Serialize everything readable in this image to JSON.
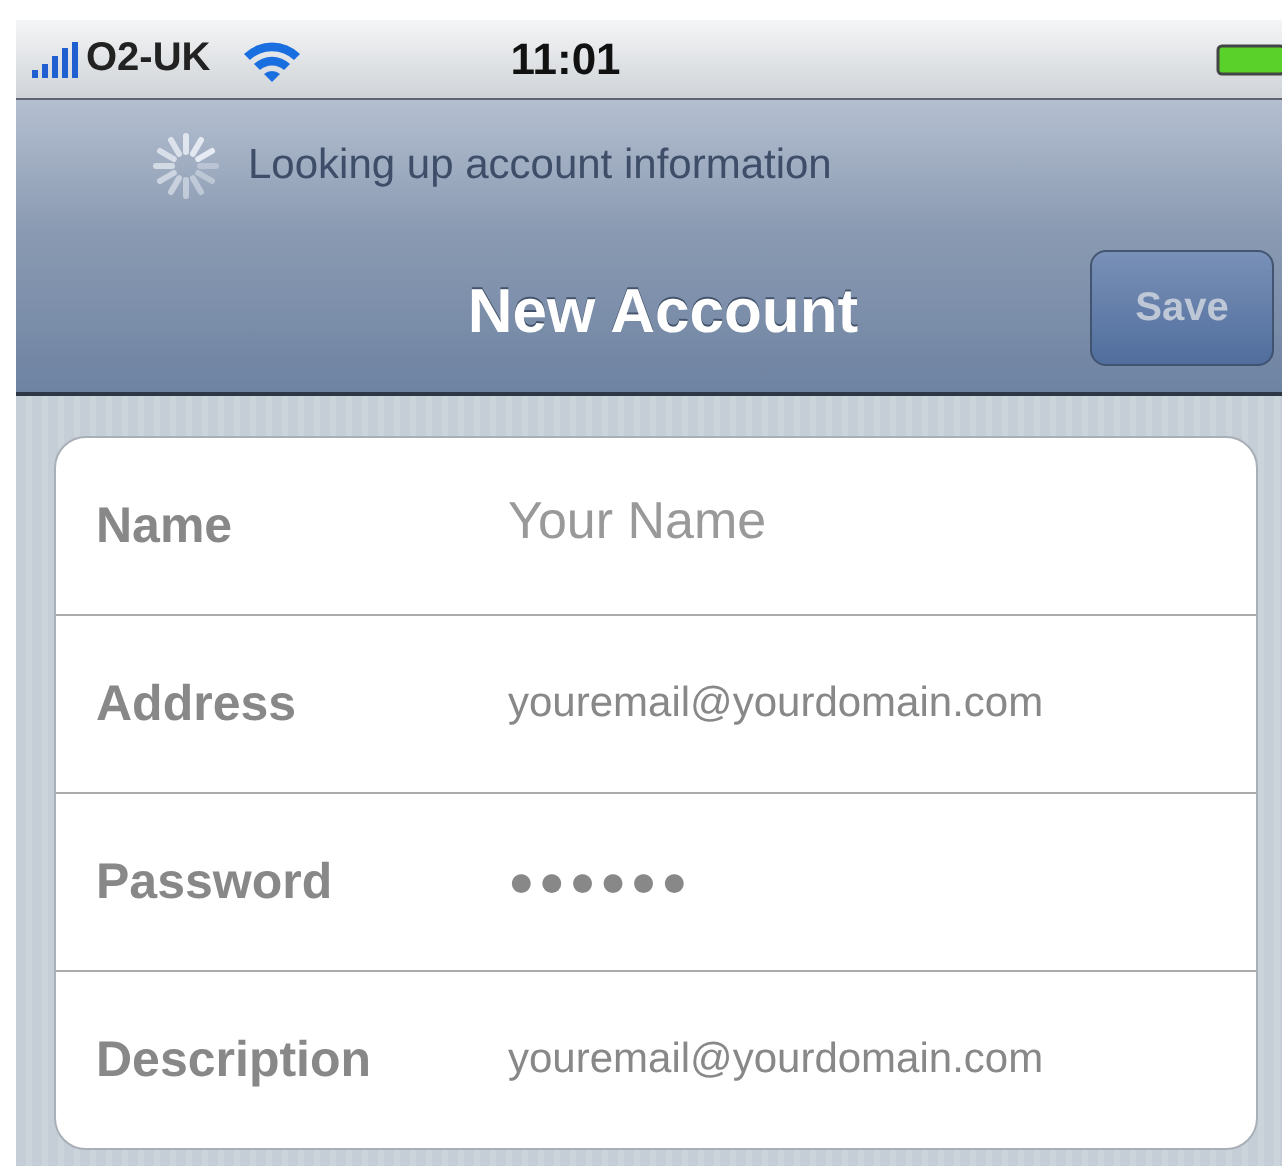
{
  "status_bar": {
    "carrier": "O2-UK",
    "time": "11:01"
  },
  "navigation_bar": {
    "activity": "Looking up account information",
    "title": "New Account",
    "save_button": {
      "label": "Save",
      "disabled": true
    }
  },
  "fields": [
    {
      "label": "Name",
      "placeholder": "Your Name"
    },
    {
      "label": "Address",
      "value": "youremail@yourdomain.com"
    },
    {
      "label": "Password",
      "value": "●●●●●●",
      "kind": "password"
    },
    {
      "label": "Description",
      "value": "youremail@yourdomain.com"
    }
  ]
}
